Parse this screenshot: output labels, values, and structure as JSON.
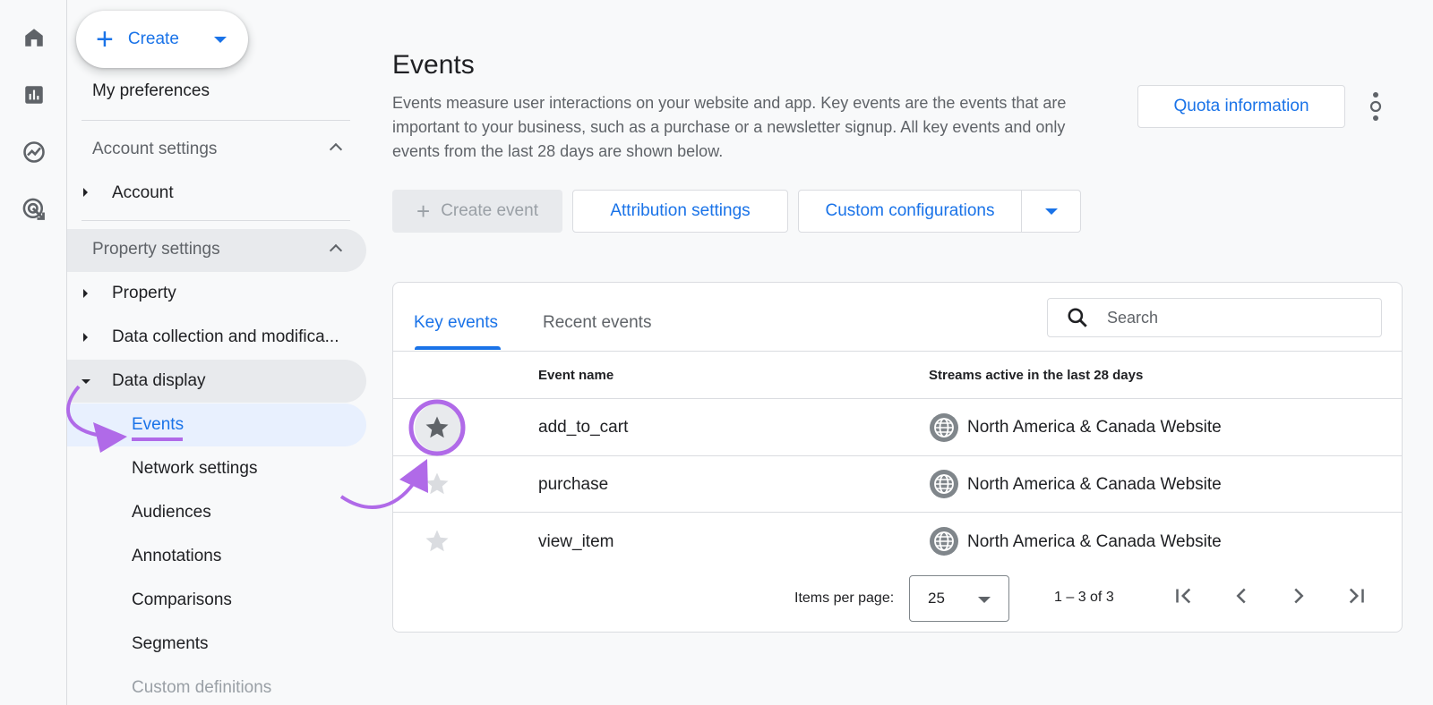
{
  "rail": {
    "icons": [
      "home-icon",
      "reports-bar-chart-icon",
      "explore-trend-icon",
      "advertising-target-icon"
    ]
  },
  "sidebar": {
    "create_label": "Create",
    "my_preferences": "My preferences",
    "account_settings": "Account settings",
    "account_item": "Account",
    "property_settings": "Property settings",
    "property_item": "Property",
    "data_collection_item": "Data collection and modifica...",
    "data_display_item": "Data display",
    "sub_items": [
      "Events",
      "Network settings",
      "Audiences",
      "Annotations",
      "Comparisons",
      "Segments",
      "Custom definitions"
    ]
  },
  "main": {
    "title": "Events",
    "description": "Events measure user interactions on your website and app. Key events are the events that are important to your business, such as a purchase or a newsletter signup. All key events and only events from the last 28 days are shown below.",
    "quota_button": "Quota information",
    "create_event_button": "Create event",
    "attribution_button": "Attribution settings",
    "custom_config_button": "Custom configurations"
  },
  "table": {
    "tabs": [
      "Key events",
      "Recent events"
    ],
    "search_placeholder": "Search",
    "headers": {
      "event_name": "Event name",
      "streams": "Streams active in the last 28 days"
    },
    "rows": [
      {
        "event": "add_to_cart",
        "stream": "North America & Canada Website",
        "starred": true
      },
      {
        "event": "purchase",
        "stream": "North America & Canada Website",
        "starred": false
      },
      {
        "event": "view_item",
        "stream": "North America & Canada Website",
        "starred": false
      }
    ],
    "items_per_page_label": "Items per page:",
    "items_per_page_value": "25",
    "range_label": "1 – 3 of 3"
  },
  "colors": {
    "accent_blue": "#1a73e8",
    "annotation_purple": "#b06ae8",
    "star_active": "#5f6368",
    "star_inactive": "#dadce0"
  }
}
